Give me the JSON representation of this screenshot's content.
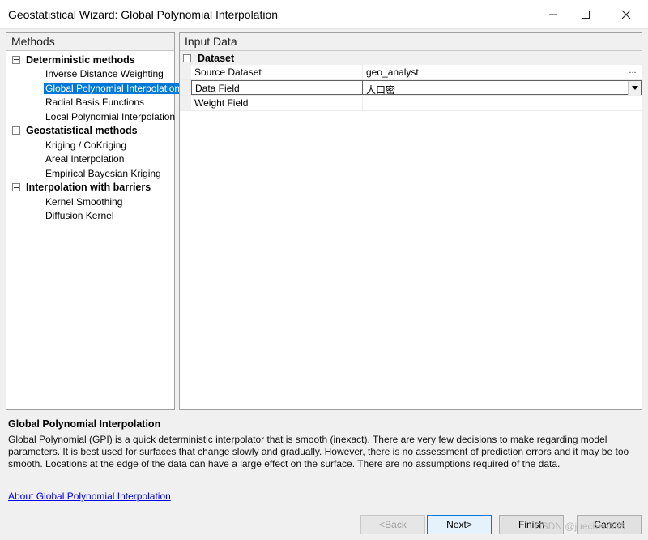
{
  "window": {
    "title": "Geostatistical Wizard: Global Polynomial Interpolation"
  },
  "methods_pane": {
    "header": "Methods",
    "groups": [
      {
        "label": "Deterministic methods",
        "items": [
          "Inverse Distance Weighting",
          "Global Polynomial Interpolation",
          "Radial Basis Functions",
          "Local Polynomial Interpolation"
        ]
      },
      {
        "label": "Geostatistical methods",
        "items": [
          "Kriging / CoKriging",
          "Areal Interpolation",
          "Empirical Bayesian Kriging"
        ]
      },
      {
        "label": "Interpolation with barriers",
        "items": [
          "Kernel Smoothing",
          "Diffusion Kernel"
        ]
      }
    ],
    "selected_item": "Global Polynomial Interpolation"
  },
  "input_pane": {
    "header": "Input Data",
    "group_label": "Dataset",
    "rows": [
      {
        "key": "Source Dataset",
        "value": "geo_analyst",
        "control": "ellipsis",
        "control_label": "..."
      },
      {
        "key": "Data Field",
        "value": "人口密",
        "control": "dropdown"
      },
      {
        "key": "Weight Field",
        "value": "",
        "control": "none"
      }
    ]
  },
  "description": {
    "title": "Global Polynomial Interpolation",
    "text": "Global Polynomial (GPI) is a quick deterministic interpolator that is smooth (inexact). There are very few decisions to make regarding model parameters. It is best used for surfaces that change slowly and gradually. However, there is no assessment of prediction errors and it may be too smooth. Locations at the edge of the data can have a large effect on the surface. There are no assumptions required of the data.",
    "link": "About Global Polynomial Interpolation"
  },
  "buttons": {
    "back": {
      "accel": "B",
      "rest": "ack",
      "prefix": "< ",
      "suffix": ""
    },
    "next": {
      "accel": "N",
      "rest": "ext",
      "prefix": "",
      "suffix": " >"
    },
    "finish": {
      "accel": "F",
      "rest": "inish",
      "prefix": "",
      "suffix": ""
    },
    "cancel": {
      "label": "Cancel"
    }
  },
  "watermark": "CSDN @juechen333",
  "colors": {
    "selection": "#0078d7",
    "link": "#0000ee"
  }
}
